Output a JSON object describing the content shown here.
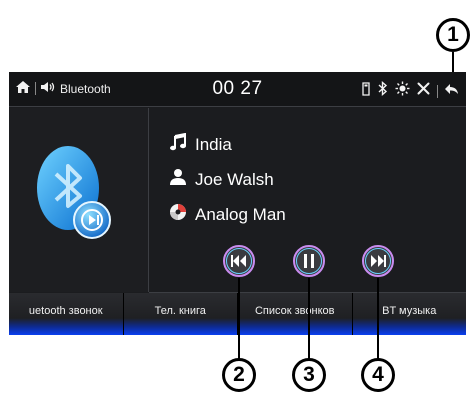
{
  "status_bar": {
    "source_label": "Bluetooth",
    "time": "00 27",
    "icons": [
      "home-icon",
      "speaker-icon",
      "sd-card-icon",
      "bluetooth-icon",
      "brightness-icon",
      "settings-icon",
      "back-icon"
    ]
  },
  "track": {
    "title": "India",
    "artist": "Joe Walsh",
    "album": "Analog Man"
  },
  "controls": [
    "previous-track-icon",
    "pause-icon",
    "next-track-icon"
  ],
  "tabs": [
    {
      "label": "uetooth звонок"
    },
    {
      "label": "Тел. книга"
    },
    {
      "label": "Список звонков"
    },
    {
      "label": "BT музыка"
    }
  ],
  "callouts": [
    "1",
    "2",
    "3",
    "4"
  ],
  "colors": {
    "screen_bg": "#1b1c1f",
    "tab_accent": "#0a3ff0",
    "bluetooth_logo": "#2aa8f0"
  }
}
